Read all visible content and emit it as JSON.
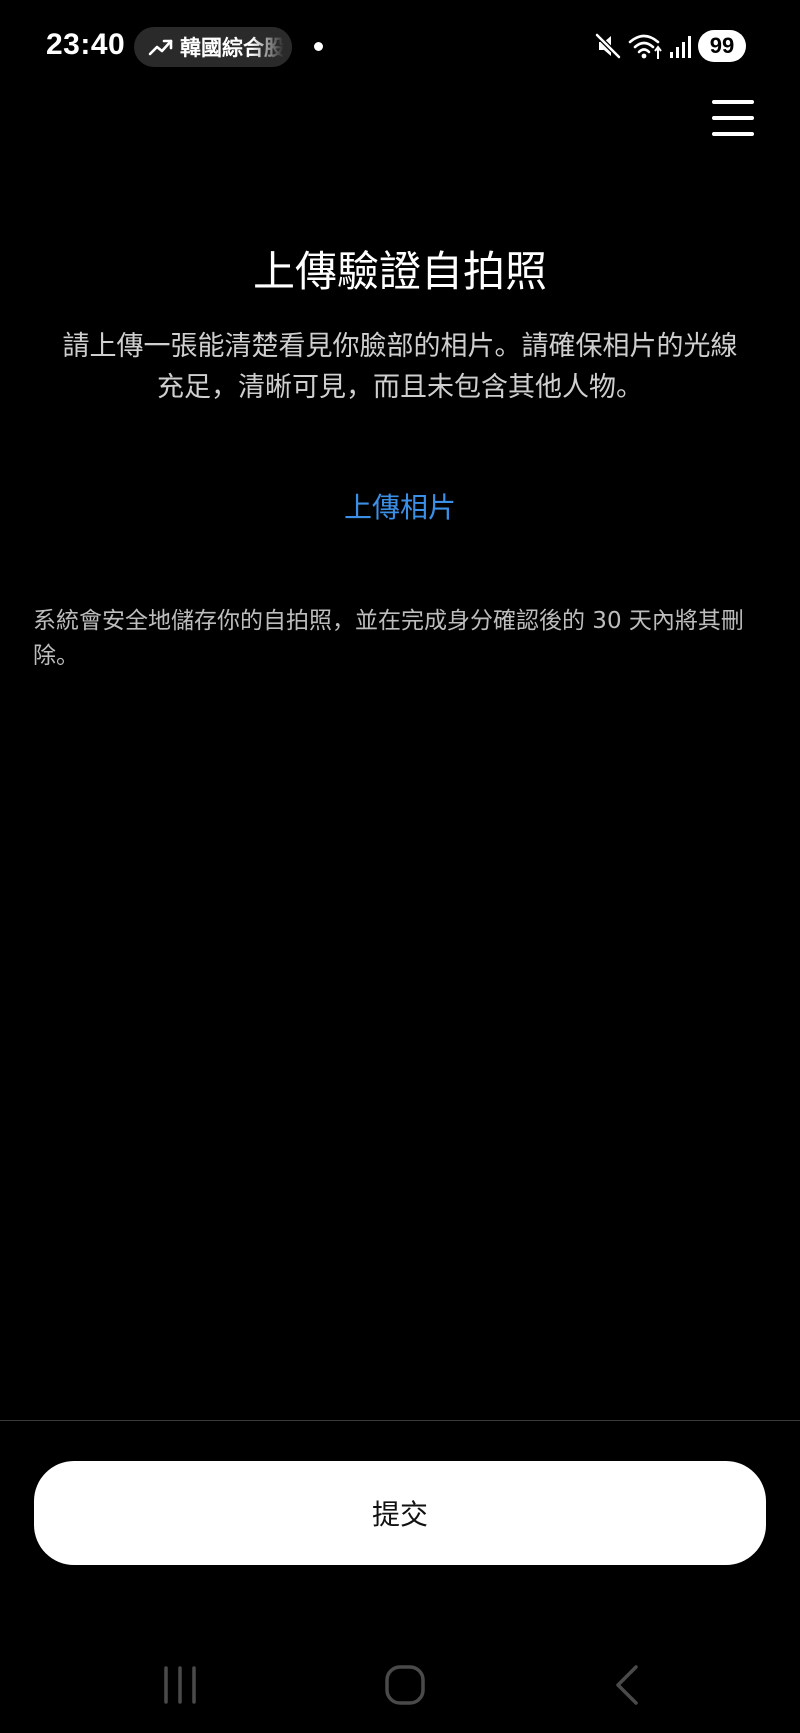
{
  "status_bar": {
    "time": "23:40",
    "ticker_text": "韓國綜合股",
    "battery": "99",
    "icons": [
      "trending-up-icon",
      "mute-icon",
      "wifi-icon",
      "signal-icon",
      "battery-icon"
    ]
  },
  "header": {
    "menu_icon": "hamburger-menu-icon"
  },
  "main": {
    "title": "上傳驗證自拍照",
    "description": "請上傳一張能清楚看見你臉部的相片。請確保相片的光線充足，清晰可見，而且未包含其他人物。",
    "upload_link": "上傳相片",
    "privacy_note": "系統會安全地儲存你的自拍照，並在完成身分確認後的 30 天內將其刪除。"
  },
  "footer": {
    "submit_label": "提交"
  },
  "nav_bar": {
    "icons": [
      "recent-apps-icon",
      "home-icon",
      "back-icon"
    ]
  },
  "colors": {
    "background": "#000000",
    "link": "#3b8fe6",
    "button_bg": "#ffffff"
  }
}
